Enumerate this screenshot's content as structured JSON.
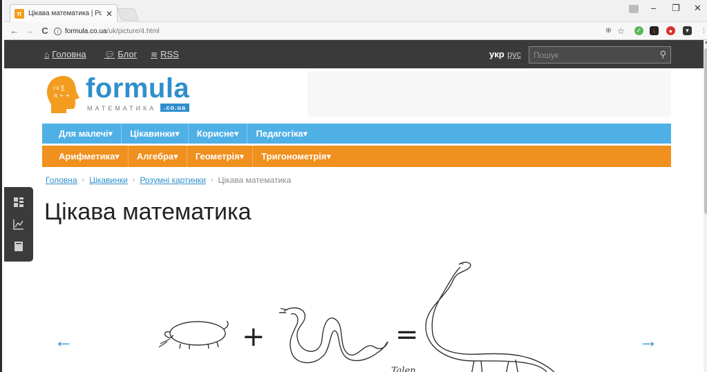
{
  "browser": {
    "tab_title": "Цікава математика | Ро:",
    "tab_favicon": "π",
    "url_host": "formula.co.ua",
    "url_path": "/uk/picture/4.html",
    "back_icon": "arrow-left-icon",
    "forward_icon": "arrow-right-icon",
    "reload_icon": "reload-icon"
  },
  "topbar": {
    "home_label": "Головна",
    "blog_label": "Блог",
    "rss_label": "RSS",
    "lang_current": "укр",
    "lang_alt": "рус",
    "search_placeholder": "Пошук"
  },
  "logo": {
    "word": "formula",
    "sub": "МАТЕМАТИКА",
    "badge": ".co.ua"
  },
  "menu_top": [
    {
      "label": "Для малечі▾"
    },
    {
      "label": "Цікавинки▾"
    },
    {
      "label": "Корисне▾"
    },
    {
      "label": "Педагогіка▾"
    }
  ],
  "menu_bottom": [
    {
      "label": "Арифметика▾"
    },
    {
      "label": "Алгебра▾"
    },
    {
      "label": "Геометрія▾"
    },
    {
      "label": "Тригонометрія▾"
    }
  ],
  "breadcrumb": {
    "items": [
      "Головна",
      "Цікавинки",
      "Розумні картинки"
    ],
    "current": "Цікава математика",
    "separator": "›"
  },
  "page_title": "Цікава математика",
  "gallery": {
    "prev": "←",
    "next": "→",
    "signature": "Talen"
  },
  "colors": {
    "accent_blue": "#4fb0e6",
    "accent_orange": "#f0901e",
    "topbar_dark": "#3a3a3a",
    "link": "#2f8fcc"
  }
}
